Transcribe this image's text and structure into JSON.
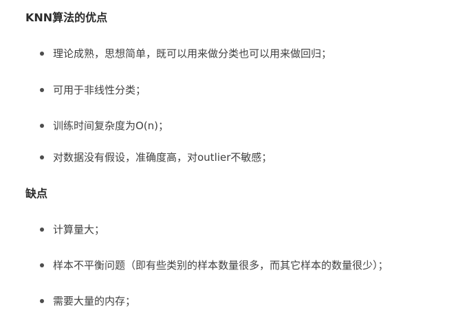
{
  "advantages": {
    "title": "KNN算法的优点",
    "items": [
      "理论成熟，思想简单，既可以用来做分类也可以用来做回归；",
      "可用于非线性分类；",
      "训练时间复杂度为O(n)；",
      "对数据没有假设，准确度高，对outlier不敏感；"
    ]
  },
  "disadvantages": {
    "title": "缺点",
    "items": [
      "计算量大；",
      "样本不平衡问题（即有些类别的样本数量很多，而其它样本的数量很少）；",
      "需要大量的内存；"
    ]
  }
}
